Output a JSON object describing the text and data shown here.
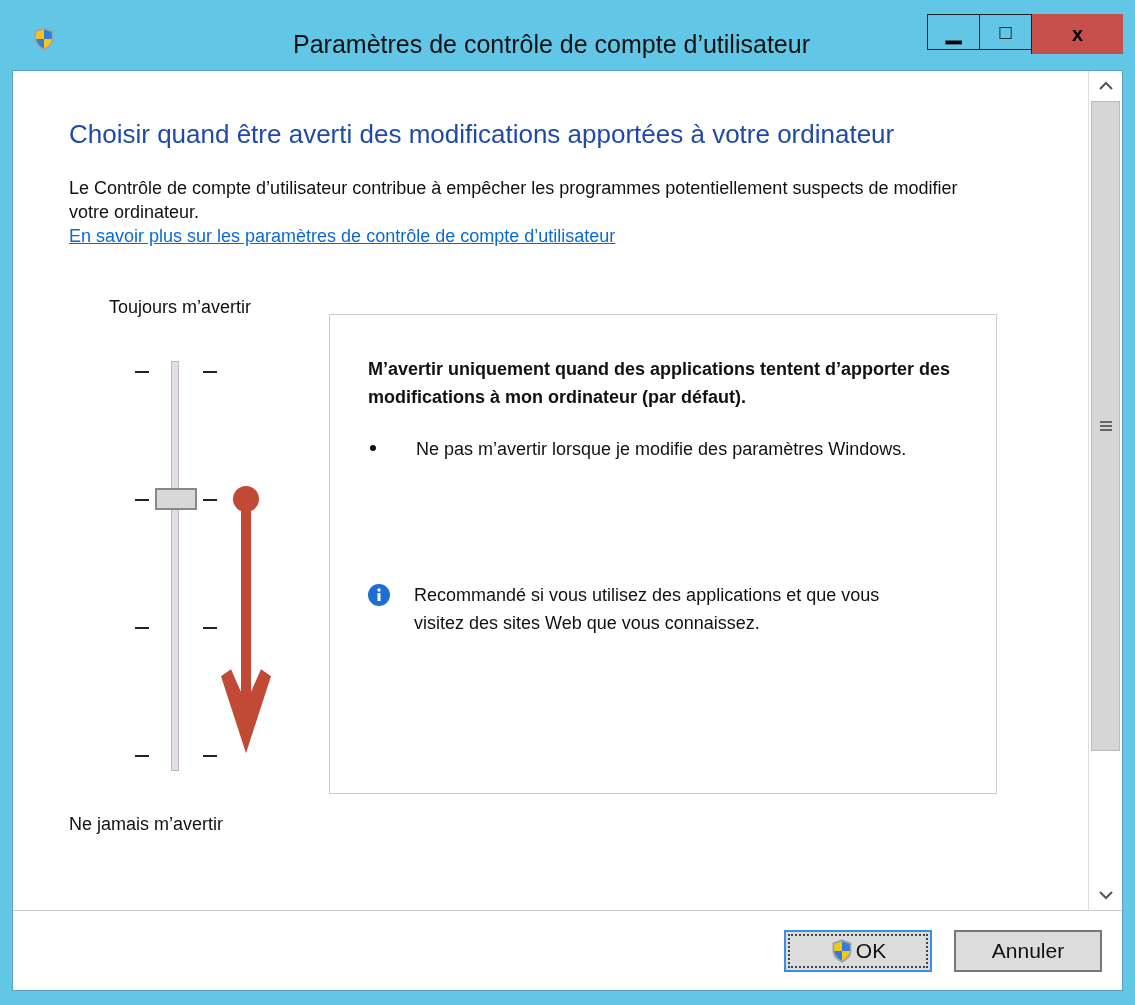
{
  "window": {
    "title": "Paramètres de contrôle de compte d’utilisateur",
    "controls": [
      "▁",
      "□",
      "x"
    ]
  },
  "heading": "Choisir quand être averti des modifications apportées à votre ordinateur",
  "description": "Le Contrôle de compte d’utilisateur contribue à empêcher les programmes potentiellement suspects de modifier votre ordinateur.",
  "link": "En savoir plus sur les paramètres de contrôle de compte d’utilisateur",
  "slider": {
    "top_label": "Toujours m’avertir",
    "bottom_label": "Ne jamais m’avertir",
    "level": 0.667
  },
  "info_panel": {
    "title": "M’avertir uniquement quand des applications tentent d’apporter des modifications à mon ordinateur (par défaut).",
    "bullets": [
      "Ne pas m’avertir lorsque je modifie des paramètres Windows."
    ],
    "note": "Recommandé si vous utilisez des applications et que vous visitez des sites Web que vous connaissez."
  },
  "buttons": [
    {
      "label": "OK",
      "shield": true,
      "focused": true
    },
    {
      "label": "Annuler",
      "shield": false,
      "focused": false
    }
  ]
}
